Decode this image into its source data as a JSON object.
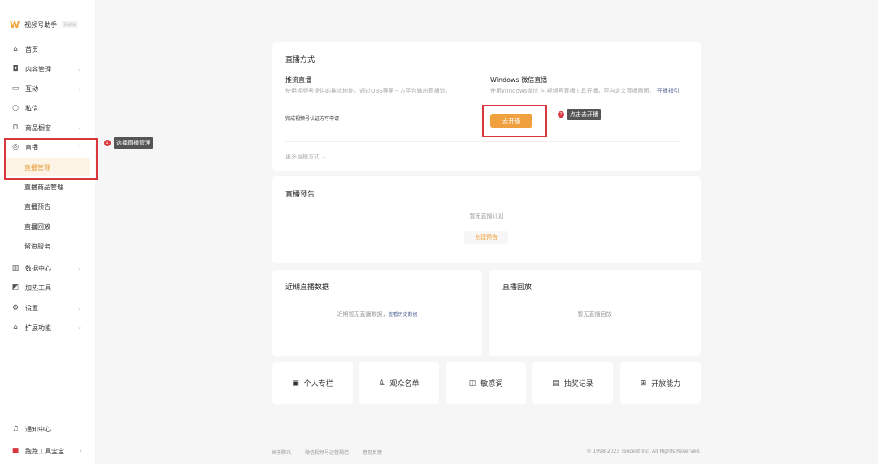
{
  "app": {
    "title": "视频号助手",
    "badge": "Beta"
  },
  "sidebar": {
    "items": [
      {
        "label": "首页",
        "icon": "home-icon"
      },
      {
        "label": "内容管理",
        "icon": "camera-icon"
      },
      {
        "label": "互动",
        "icon": "monitor-icon"
      },
      {
        "label": "私信",
        "icon": "chat-icon"
      },
      {
        "label": "商品橱窗",
        "icon": "bag-icon"
      },
      {
        "label": "直播",
        "icon": "live-icon"
      },
      {
        "label": "直播管理"
      },
      {
        "label": "直播商品管理"
      },
      {
        "label": "直播预告"
      },
      {
        "label": "直播回放"
      },
      {
        "label": "留资服务"
      },
      {
        "label": "数据中心",
        "icon": "chart-icon"
      },
      {
        "label": "加热工具",
        "icon": "boost-icon"
      },
      {
        "label": "设置",
        "icon": "gear-icon"
      },
      {
        "label": "扩展功能",
        "icon": "extension-icon"
      }
    ],
    "notifications": "通知中心",
    "user": "跑跑工具宝宝"
  },
  "annotations": {
    "step1_num": "1",
    "step1": "选择直播管理",
    "step2_num": "2",
    "step2": "点击去开播"
  },
  "live_method": {
    "title": "直播方式",
    "push": {
      "title": "推流直播",
      "desc": "使用视频号提供的推流地址，通过OBS等第三方平台输出直播流。",
      "note": "完成视频号认证方可申请"
    },
    "windows": {
      "title": "Windows 微信直播",
      "desc": "使用Windows微信 > 视频号直播工具开播，可自定义直播画面。",
      "link": "开播指引",
      "button": "去开播"
    },
    "more": "更多直播方式"
  },
  "preview": {
    "title": "直播预告",
    "empty": "暂无直播计划",
    "button": "创建预告"
  },
  "recent": {
    "title": "近期直播数据",
    "empty": "近期暂无直播数据，",
    "link": "查看历史数据"
  },
  "replay": {
    "title": "直播回放",
    "empty": "暂无直播回放"
  },
  "tools": [
    {
      "label": "个人专栏",
      "icon": "column-icon"
    },
    {
      "label": "观众名单",
      "icon": "audience-icon"
    },
    {
      "label": "敏感词",
      "icon": "text-icon"
    },
    {
      "label": "抽奖记录",
      "icon": "document-icon"
    },
    {
      "label": "开放能力",
      "icon": "open-icon"
    }
  ],
  "footer": {
    "links": [
      "关于腾讯",
      "微信视频号运营规范",
      "意见反馈"
    ],
    "copyright": "© 1998-2023 Tencent Inc. All Rights Reserved."
  },
  "colors": {
    "accent": "#f0a03c",
    "annotation": "#d9363e"
  }
}
